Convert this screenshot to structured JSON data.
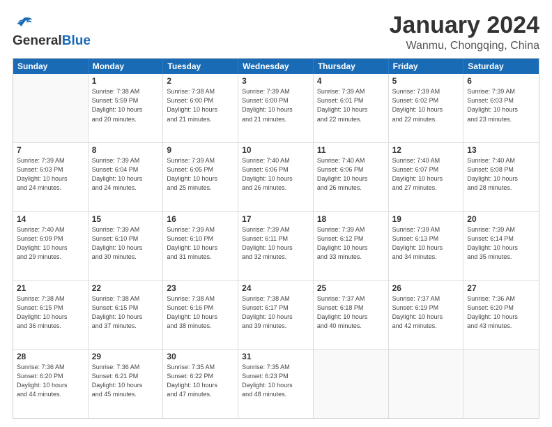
{
  "header": {
    "logo_general": "General",
    "logo_blue": "Blue",
    "title": "January 2024",
    "subtitle": "Wanmu, Chongqing, China"
  },
  "days_of_week": [
    "Sunday",
    "Monday",
    "Tuesday",
    "Wednesday",
    "Thursday",
    "Friday",
    "Saturday"
  ],
  "weeks": [
    [
      {
        "day": "",
        "info": ""
      },
      {
        "day": "1",
        "info": "Sunrise: 7:38 AM\nSunset: 5:59 PM\nDaylight: 10 hours\nand 20 minutes."
      },
      {
        "day": "2",
        "info": "Sunrise: 7:38 AM\nSunset: 6:00 PM\nDaylight: 10 hours\nand 21 minutes."
      },
      {
        "day": "3",
        "info": "Sunrise: 7:39 AM\nSunset: 6:00 PM\nDaylight: 10 hours\nand 21 minutes."
      },
      {
        "day": "4",
        "info": "Sunrise: 7:39 AM\nSunset: 6:01 PM\nDaylight: 10 hours\nand 22 minutes."
      },
      {
        "day": "5",
        "info": "Sunrise: 7:39 AM\nSunset: 6:02 PM\nDaylight: 10 hours\nand 22 minutes."
      },
      {
        "day": "6",
        "info": "Sunrise: 7:39 AM\nSunset: 6:03 PM\nDaylight: 10 hours\nand 23 minutes."
      }
    ],
    [
      {
        "day": "7",
        "info": "Sunrise: 7:39 AM\nSunset: 6:03 PM\nDaylight: 10 hours\nand 24 minutes."
      },
      {
        "day": "8",
        "info": "Sunrise: 7:39 AM\nSunset: 6:04 PM\nDaylight: 10 hours\nand 24 minutes."
      },
      {
        "day": "9",
        "info": "Sunrise: 7:39 AM\nSunset: 6:05 PM\nDaylight: 10 hours\nand 25 minutes."
      },
      {
        "day": "10",
        "info": "Sunrise: 7:40 AM\nSunset: 6:06 PM\nDaylight: 10 hours\nand 26 minutes."
      },
      {
        "day": "11",
        "info": "Sunrise: 7:40 AM\nSunset: 6:06 PM\nDaylight: 10 hours\nand 26 minutes."
      },
      {
        "day": "12",
        "info": "Sunrise: 7:40 AM\nSunset: 6:07 PM\nDaylight: 10 hours\nand 27 minutes."
      },
      {
        "day": "13",
        "info": "Sunrise: 7:40 AM\nSunset: 6:08 PM\nDaylight: 10 hours\nand 28 minutes."
      }
    ],
    [
      {
        "day": "14",
        "info": "Sunrise: 7:40 AM\nSunset: 6:09 PM\nDaylight: 10 hours\nand 29 minutes."
      },
      {
        "day": "15",
        "info": "Sunrise: 7:39 AM\nSunset: 6:10 PM\nDaylight: 10 hours\nand 30 minutes."
      },
      {
        "day": "16",
        "info": "Sunrise: 7:39 AM\nSunset: 6:10 PM\nDaylight: 10 hours\nand 31 minutes."
      },
      {
        "day": "17",
        "info": "Sunrise: 7:39 AM\nSunset: 6:11 PM\nDaylight: 10 hours\nand 32 minutes."
      },
      {
        "day": "18",
        "info": "Sunrise: 7:39 AM\nSunset: 6:12 PM\nDaylight: 10 hours\nand 33 minutes."
      },
      {
        "day": "19",
        "info": "Sunrise: 7:39 AM\nSunset: 6:13 PM\nDaylight: 10 hours\nand 34 minutes."
      },
      {
        "day": "20",
        "info": "Sunrise: 7:39 AM\nSunset: 6:14 PM\nDaylight: 10 hours\nand 35 minutes."
      }
    ],
    [
      {
        "day": "21",
        "info": "Sunrise: 7:38 AM\nSunset: 6:15 PM\nDaylight: 10 hours\nand 36 minutes."
      },
      {
        "day": "22",
        "info": "Sunrise: 7:38 AM\nSunset: 6:15 PM\nDaylight: 10 hours\nand 37 minutes."
      },
      {
        "day": "23",
        "info": "Sunrise: 7:38 AM\nSunset: 6:16 PM\nDaylight: 10 hours\nand 38 minutes."
      },
      {
        "day": "24",
        "info": "Sunrise: 7:38 AM\nSunset: 6:17 PM\nDaylight: 10 hours\nand 39 minutes."
      },
      {
        "day": "25",
        "info": "Sunrise: 7:37 AM\nSunset: 6:18 PM\nDaylight: 10 hours\nand 40 minutes."
      },
      {
        "day": "26",
        "info": "Sunrise: 7:37 AM\nSunset: 6:19 PM\nDaylight: 10 hours\nand 42 minutes."
      },
      {
        "day": "27",
        "info": "Sunrise: 7:36 AM\nSunset: 6:20 PM\nDaylight: 10 hours\nand 43 minutes."
      }
    ],
    [
      {
        "day": "28",
        "info": "Sunrise: 7:36 AM\nSunset: 6:20 PM\nDaylight: 10 hours\nand 44 minutes."
      },
      {
        "day": "29",
        "info": "Sunrise: 7:36 AM\nSunset: 6:21 PM\nDaylight: 10 hours\nand 45 minutes."
      },
      {
        "day": "30",
        "info": "Sunrise: 7:35 AM\nSunset: 6:22 PM\nDaylight: 10 hours\nand 47 minutes."
      },
      {
        "day": "31",
        "info": "Sunrise: 7:35 AM\nSunset: 6:23 PM\nDaylight: 10 hours\nand 48 minutes."
      },
      {
        "day": "",
        "info": ""
      },
      {
        "day": "",
        "info": ""
      },
      {
        "day": "",
        "info": ""
      }
    ]
  ]
}
